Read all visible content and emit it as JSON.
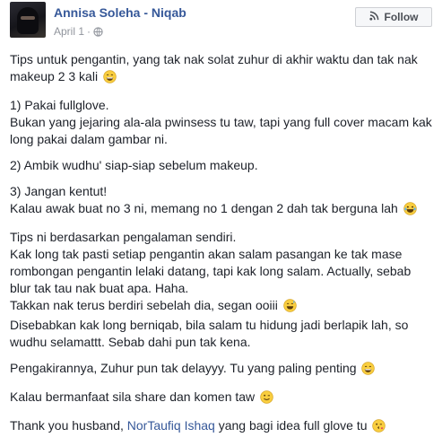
{
  "header": {
    "author": "Annisa Soleha - Niqab",
    "date": "April 1",
    "separator": "·",
    "follow_label": "Follow"
  },
  "post": {
    "paragraphs": [
      [
        "Tips untuk pengantin, yang tak nak solat zuhur di akhir waktu dan tak nak",
        "makeup 2 3 kali"
      ],
      [
        "1) Pakai fullglove.",
        "Bukan yang jejaring ala-ala pwinsess tu taw, tapi yang full cover macam kak",
        "long pakai dalam gambar ni."
      ],
      [
        "2) Ambik wudhu' siap-siap sebelum makeup."
      ],
      [
        "3) Jangan kentut!",
        "Kalau awak buat no 3 ni, memang no 1 dengan 2 dah tak berguna lah"
      ],
      [
        "Tips ni berdasarkan pengalaman sendiri.",
        "Kak long tak pasti setiap pengantin akan salam pasangan ke tak mase",
        "rombongan pengantin lelaki datang, tapi kak long salam. Actually, sebab",
        "blur tak tau nak buat apa. Haha.",
        "Takkan nak terus berdiri sebelah dia, segan ooiii",
        "Disebabkan kak long berniqab, bila salam tu hidung jadi berlapik lah, so",
        "wudhu selamattt. Sebab dahi pun tak kena."
      ],
      [
        "Pengakirannya, Zuhur pun tak delayyy. Tu yang paling penting"
      ],
      [
        "Kalau bermanfaat sila share dan komen taw"
      ]
    ],
    "thanks_prefix": "Thank you husband, ",
    "mention": "NorTaufiq Ishaq",
    "thanks_suffix": " yang bagi idea full glove tu"
  },
  "emojis": {
    "0.1": "grin",
    "3.1": "laugh",
    "4.4": "sweat-smile",
    "5.0": "grin",
    "6.0": "wink",
    "thanks": "kiss"
  }
}
